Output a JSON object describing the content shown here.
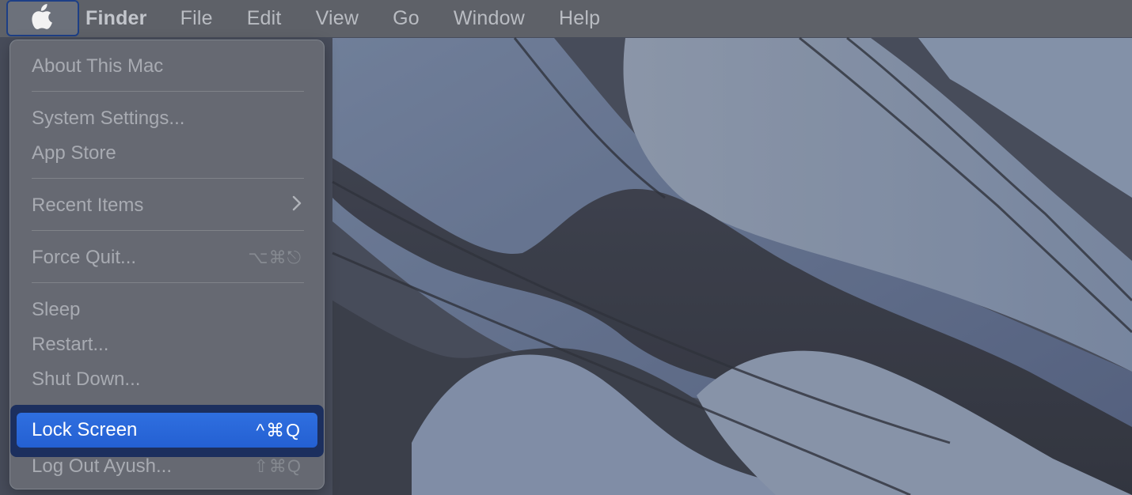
{
  "menubar": {
    "apple_icon": "apple-logo-icon",
    "items": [
      "Finder",
      "File",
      "Edit",
      "View",
      "Go",
      "Window",
      "Help"
    ]
  },
  "apple_menu": {
    "about": "About This Mac",
    "system_settings": "System Settings...",
    "app_store": "App Store",
    "recent_items": "Recent Items",
    "recent_items_icon": "chevron-right-icon",
    "force_quit": "Force Quit...",
    "force_quit_shortcut": "⌥⌘⎋",
    "sleep": "Sleep",
    "restart": "Restart...",
    "shut_down": "Shut Down...",
    "lock_screen": "Lock Screen",
    "lock_screen_shortcut": "^⌘Q",
    "log_out": "Log Out Ayush...",
    "log_out_shortcut": "⇧⌘Q"
  },
  "colors": {
    "selection": "#2a66d9",
    "menubar": "#5e6168",
    "menu_background": "#686c74"
  }
}
